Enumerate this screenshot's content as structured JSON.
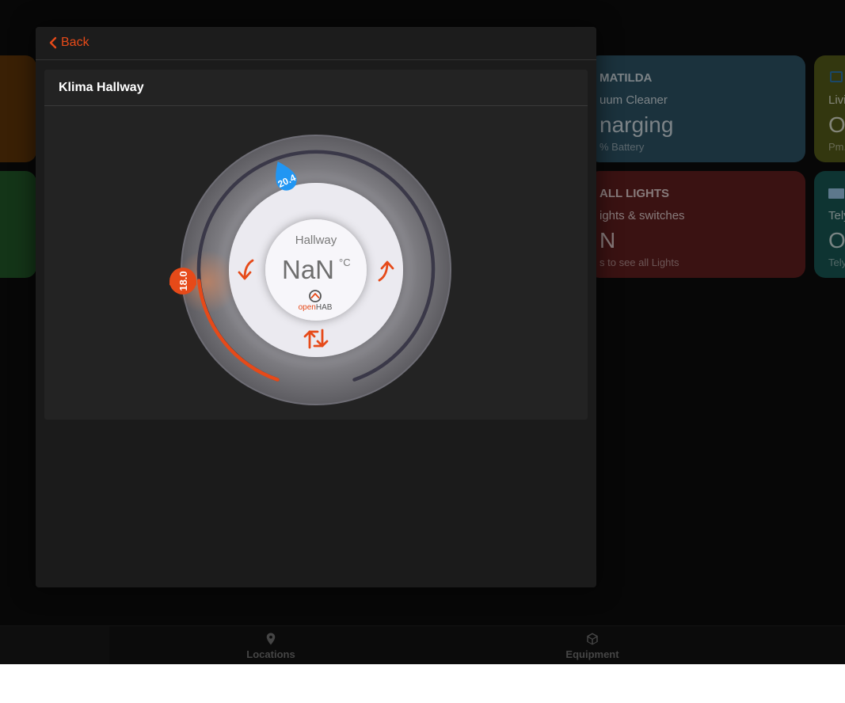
{
  "background_cards": [
    {
      "id": "orange",
      "color": "#5a3208"
    },
    {
      "id": "green",
      "color": "#1f5226"
    },
    {
      "id": "matilda",
      "color": "#2a4d5e",
      "title": "MATILDA",
      "subtitle": "uum Cleaner",
      "value": "narging",
      "footer": "% Battery"
    },
    {
      "id": "lights",
      "color": "#5a1d1d",
      "title": "ALL LIGHTS",
      "subtitle": "ights & switches",
      "value": "N",
      "footer": "s to see all Lights"
    },
    {
      "id": "living",
      "color": "#4f5518",
      "subtitle": "Livi",
      "value": "O",
      "footer": "Pm."
    },
    {
      "id": "tely",
      "color": "#16504d",
      "subtitle": "Tely",
      "value": "O",
      "footer": "Tely"
    }
  ],
  "tabbar": {
    "locations_label": "Locations",
    "equipment_label": "Equipment"
  },
  "modal": {
    "back_label": "Back",
    "panel_title": "Klima Hallway",
    "thermostat": {
      "room_label": "Hallway",
      "temperature_display": "NaN",
      "unit": "°C",
      "logo_text_open": "open",
      "logo_text_hab": "HAB",
      "setpoint": "18.0",
      "humidity_marker": "20.4",
      "accent_color": "#e64a19",
      "humidity_color": "#2196f3"
    }
  }
}
